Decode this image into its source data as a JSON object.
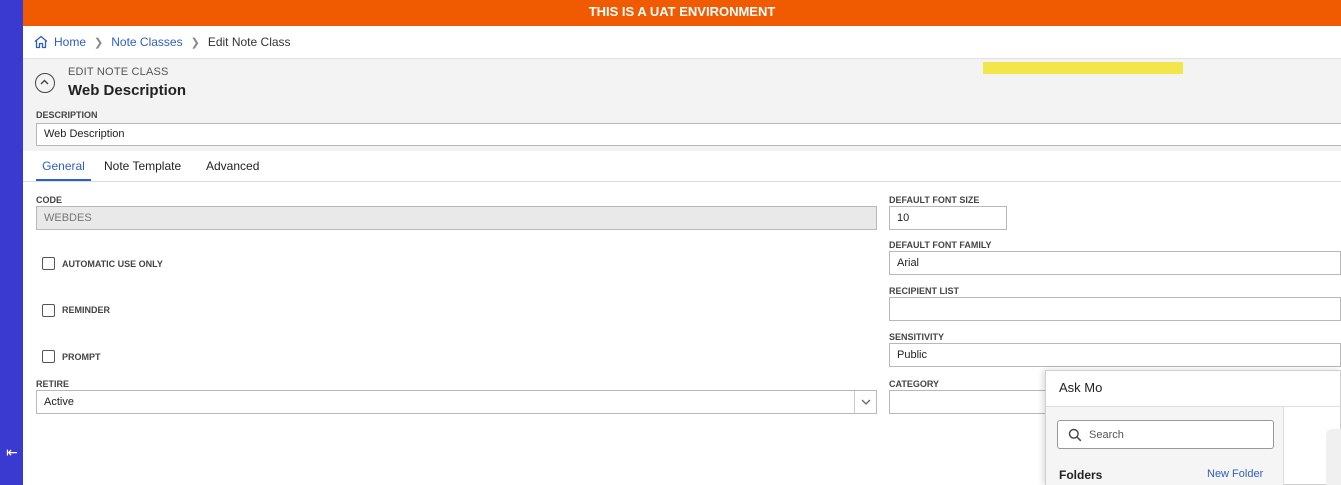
{
  "banner": {
    "text": "THIS IS A UAT ENVIRONMENT",
    "color": "#f05a00"
  },
  "breadcrumb": {
    "home": "Home",
    "note_classes": "Note Classes",
    "current": "Edit Note Class"
  },
  "header": {
    "subtitle": "EDIT NOTE CLASS",
    "title": "Web Description",
    "description_label": "DESCRIPTION",
    "description_value": "Web Description"
  },
  "tabs": [
    {
      "label": "General",
      "active": true
    },
    {
      "label": "Note Template",
      "active": false
    },
    {
      "label": "Advanced",
      "active": false
    }
  ],
  "form": {
    "code_label": "CODE",
    "code_value": "WEBDES",
    "automatic_label": "AUTOMATIC USE ONLY",
    "reminder_label": "REMINDER",
    "prompt_label": "PROMPT",
    "retire_label": "RETIRE",
    "retire_value": "Active",
    "font_size_label": "DEFAULT FONT SIZE",
    "font_size_value": "10",
    "font_family_label": "DEFAULT FONT FAMILY",
    "font_family_value": "Arial",
    "recipient_label": "RECIPIENT LIST",
    "recipient_value": "",
    "sensitivity_label": "SENSITIVITY",
    "sensitivity_value": "Public",
    "category_label": "CATEGORY",
    "category_value": ""
  },
  "askmo": {
    "title": "Ask Mo",
    "search_placeholder": "Search",
    "folders_label": "Folders",
    "new_folder_label": "New Folder"
  },
  "icons": {
    "sidebar_collapse": "collapse-left-icon",
    "home": "home-icon",
    "collapse_section": "chevron-up-circle-icon",
    "select": "chevron-down-icon",
    "search": "search-icon"
  },
  "colors": {
    "accent": "#2d5fc8",
    "sidebar": "#3a3ad0"
  }
}
